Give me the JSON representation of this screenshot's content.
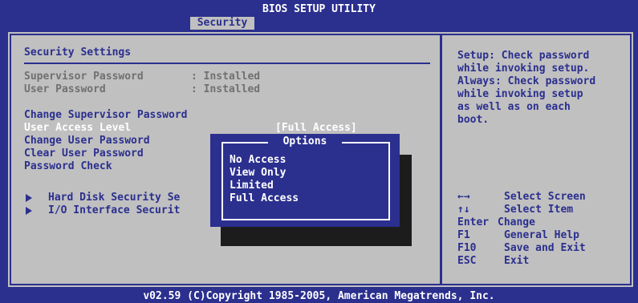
{
  "header": {
    "title": "BIOS SETUP UTILITY",
    "tabs": [
      {
        "label": "Security"
      }
    ]
  },
  "main": {
    "section_title": "Security Settings",
    "status": [
      {
        "label": "Supervisor Password",
        "value": ": Installed"
      },
      {
        "label": "User Password",
        "value": ": Installed"
      }
    ],
    "items": [
      {
        "label": "Change Supervisor Password"
      },
      {
        "label": "User Access Level",
        "value": "[Full Access]"
      },
      {
        "label": "Change User Password"
      },
      {
        "label": "Clear User Password"
      },
      {
        "label": "Password Check"
      }
    ],
    "submenus": [
      {
        "label": "Hard Disk Security Se"
      },
      {
        "label": "I/O Interface Securit"
      }
    ]
  },
  "popup": {
    "title": "Options",
    "options": [
      "No Access",
      "View Only",
      "Limited",
      "Full Access"
    ]
  },
  "help": {
    "lines": [
      "Setup: Check password",
      "while invoking setup.",
      "Always: Check password",
      "while invoking setup",
      "as well as on each",
      "boot."
    ]
  },
  "keys": [
    {
      "key": "←→",
      "action": "Select Screen"
    },
    {
      "key": "↑↓",
      "action": "Select Item"
    },
    {
      "key": "Enter",
      "action": "Change"
    },
    {
      "key": "F1",
      "action": "General Help"
    },
    {
      "key": "F10",
      "action": "Save and Exit"
    },
    {
      "key": "ESC",
      "action": "Exit"
    }
  ],
  "footer": {
    "text": "v02.59 (C)Copyright 1985-2005, American Megatrends, Inc."
  },
  "colors": {
    "background": "#2b2f8e",
    "panel": "#c0c0c0",
    "text_dark": "#2b2f8e",
    "text_disabled": "#707070",
    "text_highlight": "#ffffff"
  }
}
